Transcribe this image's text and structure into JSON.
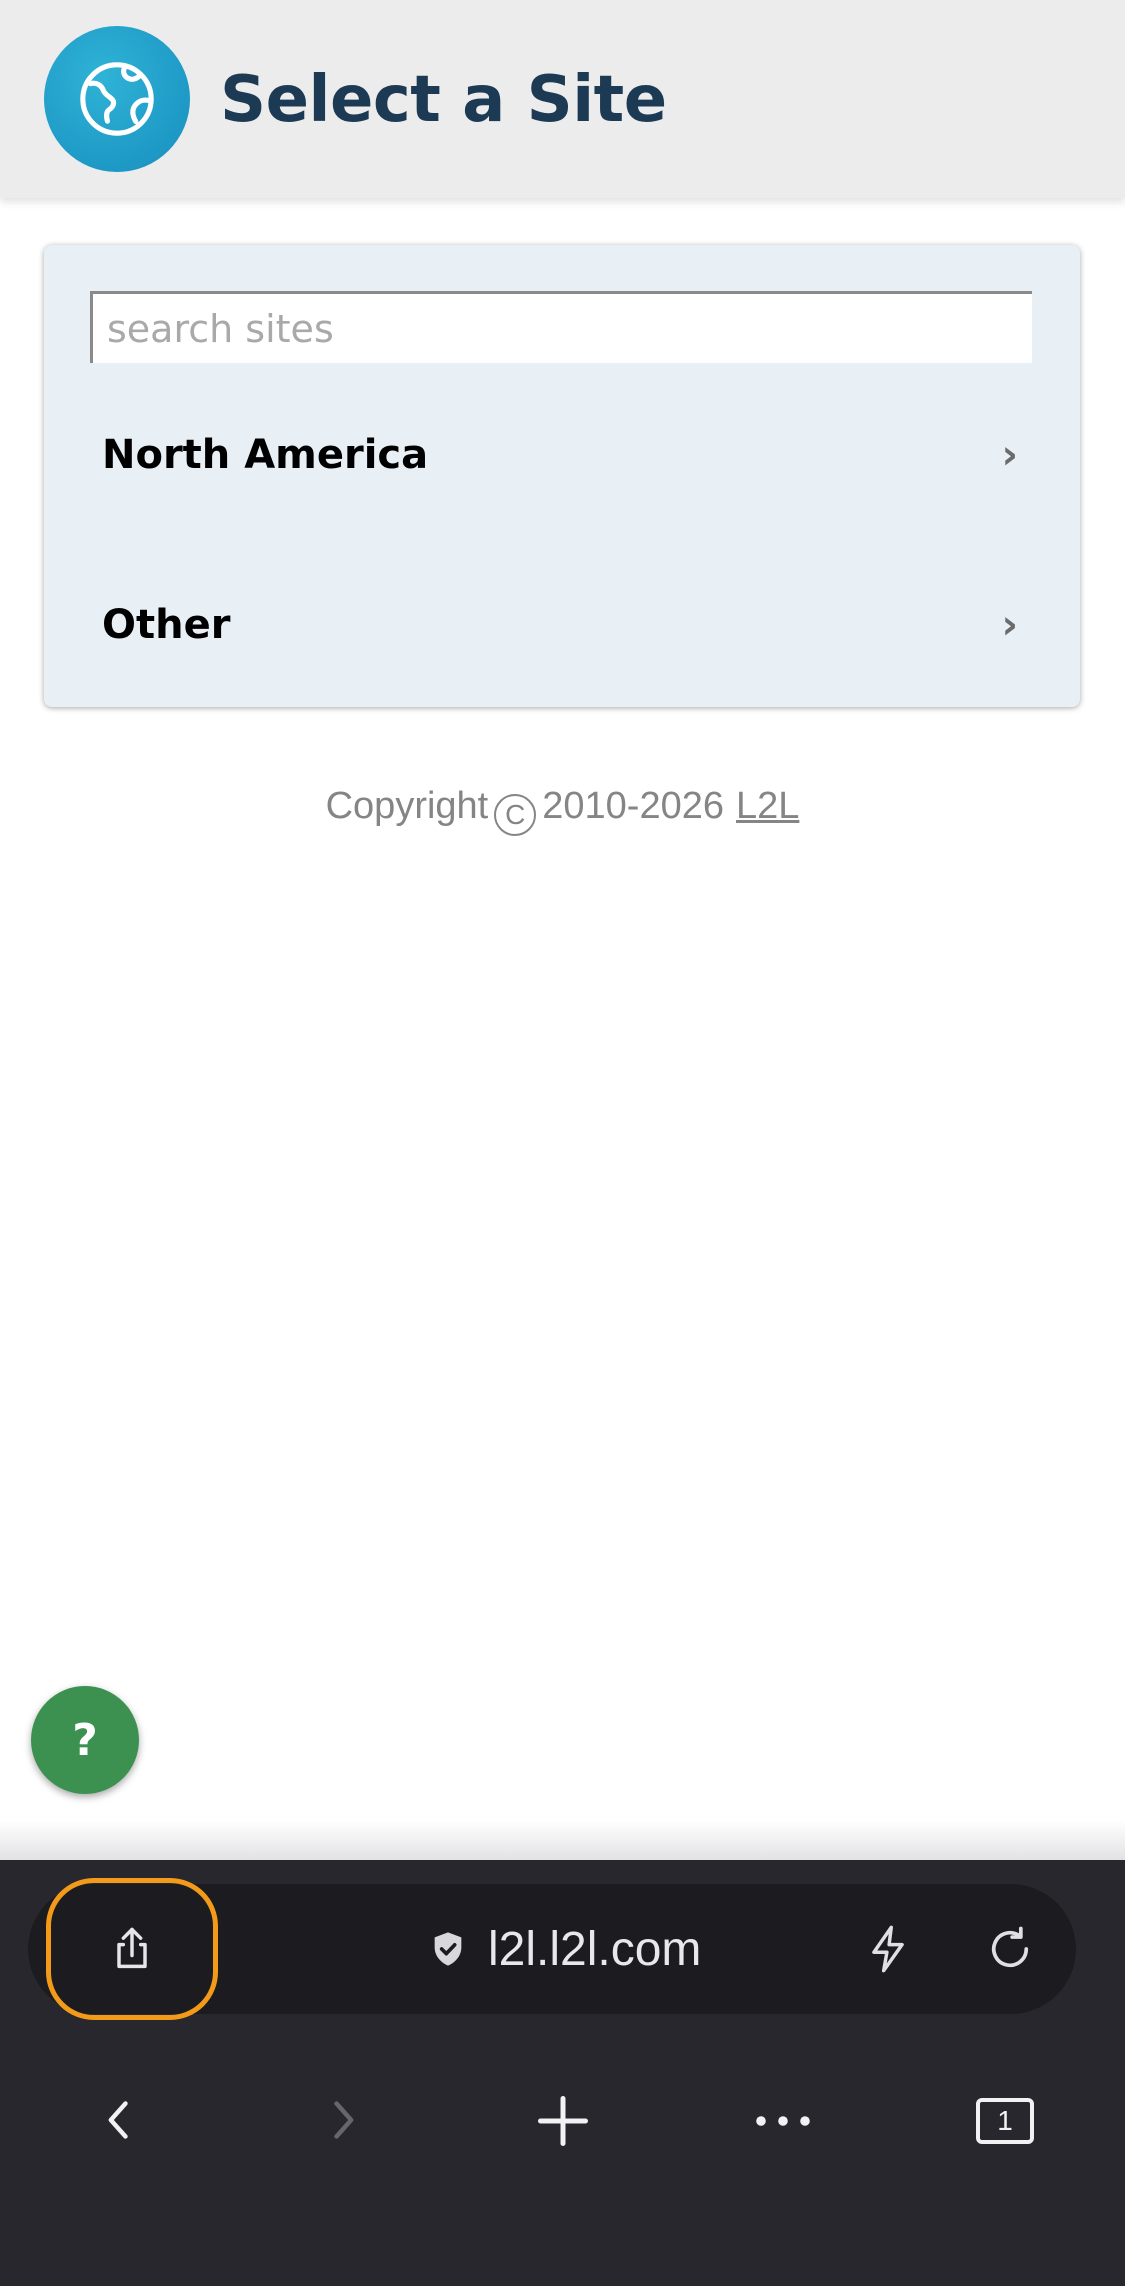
{
  "header": {
    "title": "Select a Site",
    "logo_icon": "globe-icon"
  },
  "search": {
    "placeholder": "search sites",
    "value": ""
  },
  "regions": [
    {
      "label": "North America",
      "chevron": "›"
    },
    {
      "label": "Other",
      "chevron": "›"
    }
  ],
  "footer": {
    "copyright_prefix": "Copyright",
    "copyright_symbol": "C",
    "years": "2010-2026",
    "link": "L2L"
  },
  "help_button": {
    "label": "?"
  },
  "browser": {
    "url": "l2l.l2l.com",
    "tab_count": "1",
    "icons": [
      "share-icon",
      "shield-check-icon",
      "lightning-icon",
      "reload-icon",
      "back-icon",
      "forward-icon",
      "new-tab-icon",
      "more-icon",
      "tabs-icon"
    ]
  },
  "colors": {
    "accent": "#1e99c6",
    "title": "#1d3a55",
    "card_bg": "#e8f0f5",
    "help_green": "#3d9150",
    "highlight_orange": "#f39a18"
  }
}
